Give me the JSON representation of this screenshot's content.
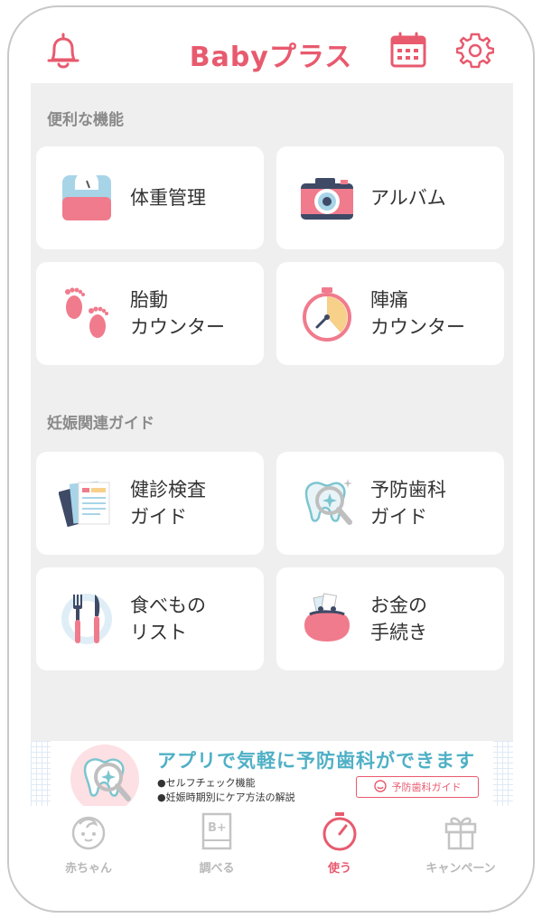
{
  "header": {
    "logo": "Babyプラス",
    "icons": [
      "bell-icon",
      "calendar-icon",
      "gear-icon"
    ],
    "accent": "#e85a6e"
  },
  "sections": [
    {
      "title": "便利な機能",
      "cards": [
        {
          "label": "体重管理",
          "icon": "scale-icon"
        },
        {
          "label": "アルバム",
          "icon": "camera-icon"
        },
        {
          "label": "胎動\nカウンター",
          "icon": "footprints-icon"
        },
        {
          "label": "陣痛\nカウンター",
          "icon": "stopwatch-icon"
        }
      ]
    },
    {
      "title": "妊娠関連ガイド",
      "cards": [
        {
          "label": "健診検査\nガイド",
          "icon": "documents-icon"
        },
        {
          "label": "予防歯科\nガイド",
          "icon": "tooth-icon"
        },
        {
          "label": "食べもの\nリスト",
          "icon": "fork-knife-icon"
        },
        {
          "label": "お金の\n手続き",
          "icon": "purse-icon"
        }
      ]
    }
  ],
  "banner": {
    "title": "アプリで気軽に予防歯科ができます",
    "bullet1": "●セルフチェック機能",
    "bullet2": "●妊娠時期別にケア方法の解説",
    "button": "予防歯科ガイド"
  },
  "tabs": [
    {
      "label": "赤ちゃん",
      "icon": "baby-face-icon",
      "active": false
    },
    {
      "label": "調べる",
      "icon": "book-icon",
      "active": false
    },
    {
      "label": "使う",
      "icon": "stopwatch-icon",
      "active": true
    },
    {
      "label": "キャンペーン",
      "icon": "gift-icon",
      "active": false
    }
  ]
}
